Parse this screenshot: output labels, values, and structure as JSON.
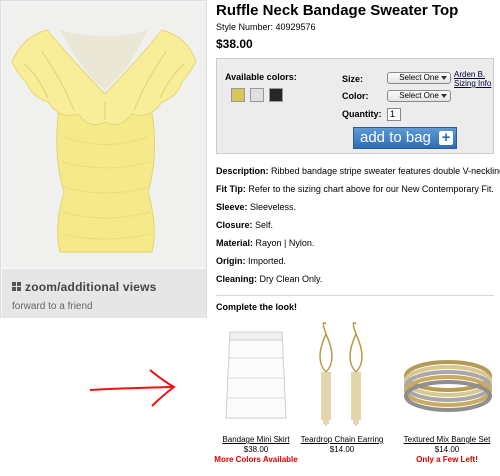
{
  "product": {
    "title": "Ruffle Neck Bandage Sweater Top",
    "style_number": "Style Number: 40929576",
    "price": "$38.00"
  },
  "image_panel": {
    "zoom_label": "zoom/additional views",
    "forward_label": "forward to a friend"
  },
  "options": {
    "available_colors_label": "Available colors:",
    "colors": [
      "#d8c55a",
      "#e0e0e0",
      "#262626"
    ],
    "size_label": "Size:",
    "size_value": "Select One",
    "color_label": "Color:",
    "color_value": "Select One",
    "quantity_label": "Quantity:",
    "quantity_value": "1",
    "sizing_line1": "Arden B.",
    "sizing_line2": "Sizing Info",
    "add_to_bag": "add to bag"
  },
  "details": [
    {
      "label": "Description:",
      "text": " Ribbed bandage stripe sweater features double V-neckline"
    },
    {
      "label": "Fit Tip:",
      "text": " Refer to the sizing chart above for our New Contemporary Fit."
    },
    {
      "label": "Sleeve:",
      "text": " Sleeveless."
    },
    {
      "label": "Closure:",
      "text": " Self."
    },
    {
      "label": "Material:",
      "text": " Rayon | Nylon."
    },
    {
      "label": "Origin:",
      "text": " Imported."
    },
    {
      "label": "Cleaning:",
      "text": " Dry Clean Only."
    }
  ],
  "complete_look": {
    "title": "Complete the look!",
    "items": [
      {
        "name": "Bandage Mini Skirt",
        "price": "$38.00",
        "note": "More Colors Available"
      },
      {
        "name": "Teardrop Chain Earring",
        "price": "$14.00",
        "note": ""
      },
      {
        "name": "Textured Mix Bangle Set",
        "price": "$14.00",
        "note": "Only a Few Left!"
      }
    ]
  }
}
